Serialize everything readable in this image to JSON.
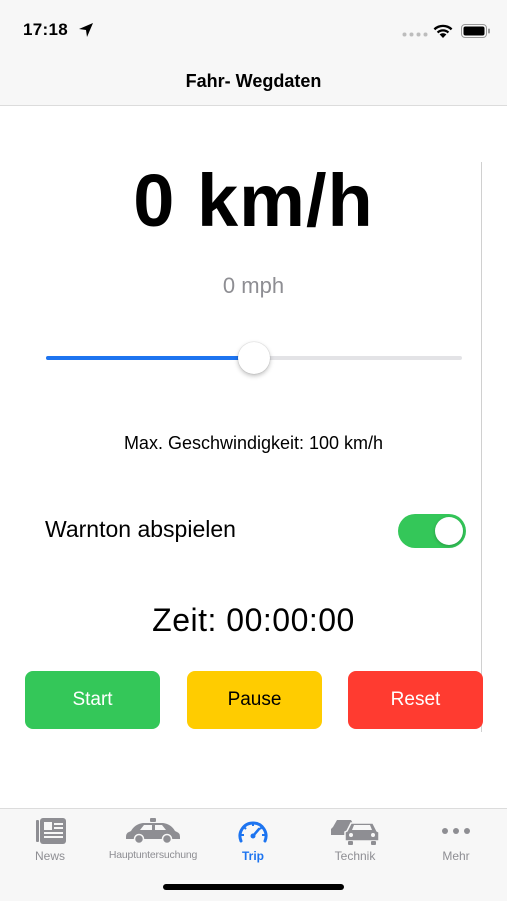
{
  "status_bar": {
    "time": "17:18"
  },
  "nav": {
    "title": "Fahr- Wegdaten"
  },
  "speed": {
    "kmh": "0 km/h",
    "mph": "0 mph"
  },
  "slider": {
    "fraction": 0.5
  },
  "max_speed_text": "Max. Geschwindigkeit: 100 km/h",
  "warn": {
    "label": "Warnton abspielen",
    "enabled": true
  },
  "timer": "Zeit: 00:00:00",
  "buttons": {
    "start": "Start",
    "pause": "Pause",
    "reset": "Reset"
  },
  "tabs": [
    {
      "label": "News",
      "icon": "news-icon",
      "active": false
    },
    {
      "label": "Hauptuntersuchung",
      "icon": "car-inspection-icon",
      "active": false
    },
    {
      "label": "Trip",
      "icon": "speedometer-icon",
      "active": true
    },
    {
      "label": "Technik",
      "icon": "cars-icon",
      "active": false
    },
    {
      "label": "Mehr",
      "icon": "more-dots-icon",
      "active": false
    }
  ],
  "colors": {
    "accent": "#1d74f0",
    "start": "#34c759",
    "pause": "#ffcc00",
    "reset": "#ff3b30",
    "toggle_on": "#34c759"
  }
}
